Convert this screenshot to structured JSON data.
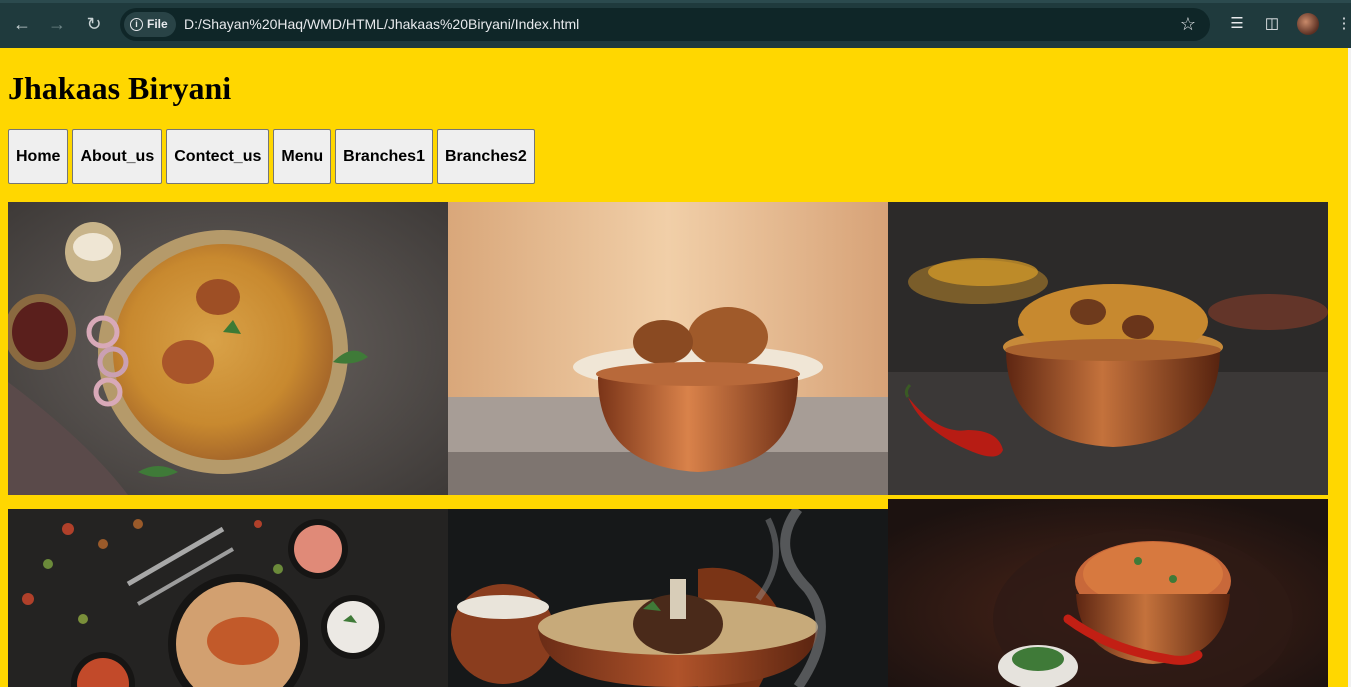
{
  "browser": {
    "file_chip": "File",
    "url": "D:/Shayan%20Haq/WMD/HTML/Jhakaas%20Biryani/Index.html"
  },
  "site": {
    "title": "Jhakaas Biryani",
    "nav": [
      "Home",
      "About_us",
      "Contect_us",
      "Menu",
      "Branches1",
      "Branches2"
    ]
  },
  "colors": {
    "page_background": "#ffd700",
    "button_background": "#efefef",
    "chrome_background": "#1f3a3d"
  },
  "gallery": {
    "images": [
      {
        "subject": "biryani platter with onions and raita on dark stone"
      },
      {
        "subject": "biryani in copper handi on peach background"
      },
      {
        "subject": "biryani in copper bowl with red chili on dark background"
      },
      {
        "subject": "biryani with chicken leg and sides, top view"
      },
      {
        "subject": "mutton biryani in clay pot with steam"
      },
      {
        "subject": "biryani in copper bowl with chili and coriander"
      }
    ]
  }
}
